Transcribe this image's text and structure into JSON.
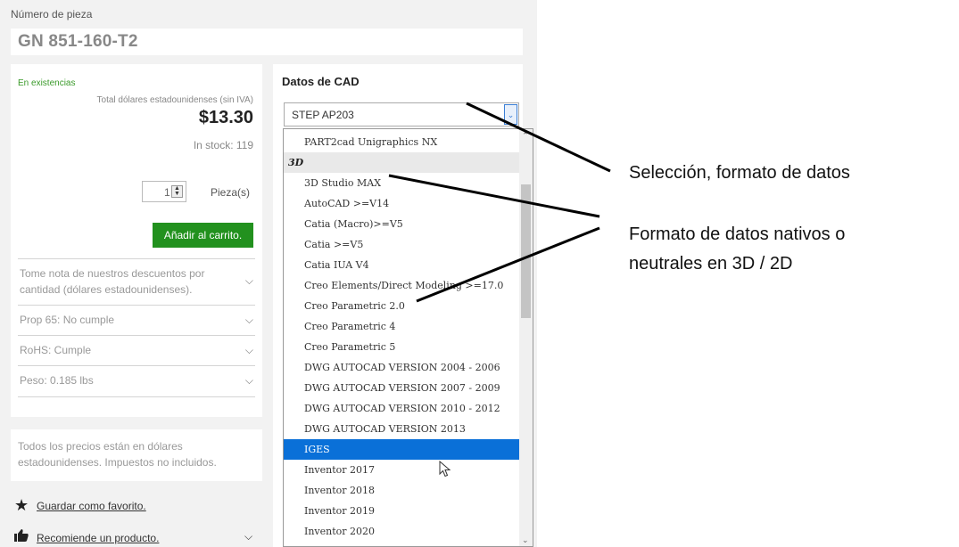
{
  "part": {
    "label": "Número de pieza",
    "number": "GN 851-160-T2"
  },
  "pricing": {
    "stock_status": "En existencias",
    "caption": "Total dólares estadounidenses (sin IVA)",
    "price": "$13.30",
    "in_stock": "In stock: 119",
    "quantity": "1",
    "unit": "Pieza(s)",
    "add_to_cart": "Añadir al carrito."
  },
  "accordion": [
    {
      "label": "Tome nota de nuestros descuentos por cantidad (dólares estadounidenses)."
    },
    {
      "label": "Prop 65: No cumple"
    },
    {
      "label": "RoHS: Cumple"
    },
    {
      "label": "Peso: 0.185 lbs"
    }
  ],
  "notice": "Todos los precios están en dólares estadounidenses. Impuestos no incluidos.",
  "links": {
    "favorite": "Guardar como favorito.",
    "recommend": "Recomiende un producto."
  },
  "cad": {
    "title": "Datos de CAD",
    "selected_format": "STEP AP203",
    "options": [
      {
        "label": "PART2cad Unigraphics NX",
        "group": false
      },
      {
        "label": "3D",
        "group": true
      },
      {
        "label": "3D Studio MAX",
        "group": false
      },
      {
        "label": "AutoCAD >=V14",
        "group": false
      },
      {
        "label": "Catia (Macro)>=V5",
        "group": false
      },
      {
        "label": "Catia >=V5",
        "group": false
      },
      {
        "label": "Catia IUA V4",
        "group": false
      },
      {
        "label": "Creo Elements/Direct Modeling >=17.0",
        "group": false
      },
      {
        "label": "Creo Parametric 2.0",
        "group": false
      },
      {
        "label": "Creo Parametric 4",
        "group": false
      },
      {
        "label": "Creo Parametric 5",
        "group": false
      },
      {
        "label": "DWG AUTOCAD VERSION 2004 - 2006",
        "group": false
      },
      {
        "label": "DWG AUTOCAD VERSION 2007 - 2009",
        "group": false
      },
      {
        "label": "DWG AUTOCAD VERSION 2010 - 2012",
        "group": false
      },
      {
        "label": "DWG AUTOCAD VERSION 2013",
        "group": false
      },
      {
        "label": "IGES",
        "group": false,
        "selected": true
      },
      {
        "label": "Inventor 2017",
        "group": false
      },
      {
        "label": "Inventor 2018",
        "group": false
      },
      {
        "label": "Inventor 2019",
        "group": false
      },
      {
        "label": "Inventor 2020",
        "group": false
      }
    ]
  },
  "annotations": {
    "format_selection": "Selección, formato de datos",
    "native_formats_line1": "Formato de datos nativos o",
    "native_formats_line2": "neutrales en 3D / 2D"
  },
  "colors": {
    "stock_green": "#3a9a2a",
    "button_green": "#22911e",
    "selected_blue": "#0a70d8"
  }
}
